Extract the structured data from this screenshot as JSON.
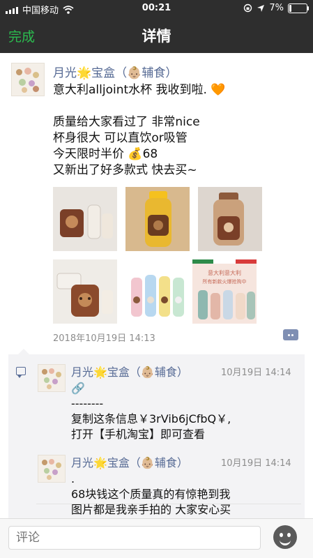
{
  "status_bar": {
    "carrier": "中国移动",
    "time": "00:21",
    "battery": "7%"
  },
  "nav": {
    "back_label": "完成",
    "title": "详情"
  },
  "post": {
    "author": "月光🌟宝盒（👶🏼辅食）",
    "text": "意大利alljoint水杯  我收到啦. 🧡\n\n质量给大家看过了  非常nice\n杯身很大  可以直饮or吸管\n今天限时半价 💰68\n又新出了好多款式  快去买~",
    "timestamp": "2018年10月19日 14:13",
    "photo_overlay_text": [
      "意大利意大利",
      "所有新款火爆抢购中"
    ]
  },
  "comments": [
    {
      "author": "月光🌟宝盒（👶🏼辅食）",
      "time": "10月19日 14:14",
      "text": "🔗\n  --------\n复制这条信息￥3rVib6jCfbQ￥,\n打开【手机淘宝】即可查看"
    },
    {
      "author": "月光🌟宝盒（👶🏼辅食）",
      "time": "10月19日 14:14",
      "text": ".\n68块钱这个质量真的有惊艳到我\n图片都是我亲手拍的 大家安心买"
    }
  ],
  "comment_input": {
    "placeholder": "评论"
  },
  "colors": {
    "nav_bg": "#2e2e2e",
    "accent_green": "#2bbc4f",
    "name_blue": "#576b95"
  }
}
